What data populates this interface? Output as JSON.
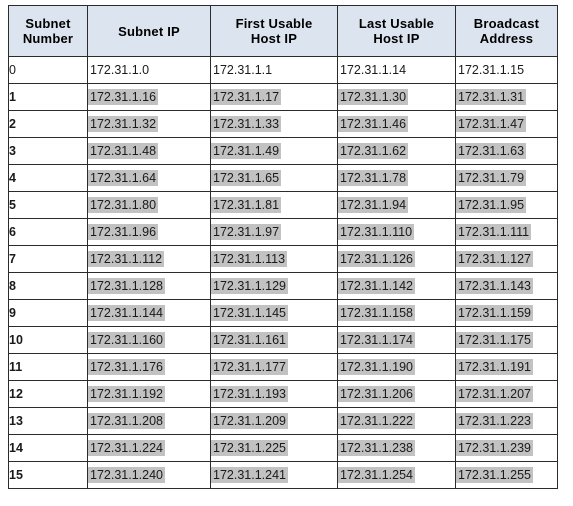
{
  "table": {
    "headers": [
      {
        "line1": "Subnet",
        "line2": "Number"
      },
      {
        "line1": "Subnet IP",
        "line2": ""
      },
      {
        "line1": "First Usable",
        "line2": "Host IP"
      },
      {
        "line1": "Last Usable",
        "line2": "Host IP"
      },
      {
        "line1": "Broadcast",
        "line2": "Address"
      }
    ],
    "rows": [
      {
        "number": "0",
        "subnet_ip": "172.31.1.0",
        "first_host": "172.31.1.1",
        "last_host": "172.31.1.14",
        "broadcast": "172.31.1.15",
        "highlighted": false
      },
      {
        "number": "1",
        "subnet_ip": "172.31.1.16",
        "first_host": "172.31.1.17",
        "last_host": "172.31.1.30",
        "broadcast": "172.31.1.31",
        "highlighted": true
      },
      {
        "number": "2",
        "subnet_ip": "172.31.1.32",
        "first_host": "172.31.1.33",
        "last_host": "172.31.1.46",
        "broadcast": "172.31.1.47",
        "highlighted": true
      },
      {
        "number": "3",
        "subnet_ip": "172.31.1.48",
        "first_host": "172.31.1.49",
        "last_host": "172.31.1.62",
        "broadcast": "172.31.1.63",
        "highlighted": true
      },
      {
        "number": "4",
        "subnet_ip": "172.31.1.64",
        "first_host": "172.31.1.65",
        "last_host": "172.31.1.78",
        "broadcast": "172.31.1.79",
        "highlighted": true
      },
      {
        "number": "5",
        "subnet_ip": "172.31.1.80",
        "first_host": "172.31.1.81",
        "last_host": "172.31.1.94",
        "broadcast": "172.31.1.95",
        "highlighted": true
      },
      {
        "number": "6",
        "subnet_ip": "172.31.1.96",
        "first_host": "172.31.1.97",
        "last_host": "172.31.1.110",
        "broadcast": "172.31.1.111",
        "highlighted": true
      },
      {
        "number": "7",
        "subnet_ip": "172.31.1.112",
        "first_host": "172.31.1.113",
        "last_host": "172.31.1.126",
        "broadcast": "172.31.1.127",
        "highlighted": true
      },
      {
        "number": "8",
        "subnet_ip": "172.31.1.128",
        "first_host": "172.31.1.129",
        "last_host": "172.31.1.142",
        "broadcast": "172.31.1.143",
        "highlighted": true
      },
      {
        "number": "9",
        "subnet_ip": "172.31.1.144",
        "first_host": "172.31.1.145",
        "last_host": "172.31.1.158",
        "broadcast": "172.31.1.159",
        "highlighted": true
      },
      {
        "number": "10",
        "subnet_ip": "172.31.1.160",
        "first_host": "172.31.1.161",
        "last_host": "172.31.1.174",
        "broadcast": "172.31.1.175",
        "highlighted": true
      },
      {
        "number": "11",
        "subnet_ip": "172.31.1.176",
        "first_host": "172.31.1.177",
        "last_host": "172.31.1.190",
        "broadcast": "172.31.1.191",
        "highlighted": true
      },
      {
        "number": "12",
        "subnet_ip": "172.31.1.192",
        "first_host": "172.31.1.193",
        "last_host": "172.31.1.206",
        "broadcast": "172.31.1.207",
        "highlighted": true
      },
      {
        "number": "13",
        "subnet_ip": "172.31.1.208",
        "first_host": "172.31.1.209",
        "last_host": "172.31.1.222",
        "broadcast": "172.31.1.223",
        "highlighted": true
      },
      {
        "number": "14",
        "subnet_ip": "172.31.1.224",
        "first_host": "172.31.1.225",
        "last_host": "172.31.1.238",
        "broadcast": "172.31.1.239",
        "highlighted": true
      },
      {
        "number": "15",
        "subnet_ip": "172.31.1.240",
        "first_host": "172.31.1.241",
        "last_host": "172.31.1.254",
        "broadcast": "172.31.1.255",
        "highlighted": true
      }
    ]
  },
  "colors": {
    "header_bg": "#dce4ef",
    "highlight_bg": "#c2c2c2",
    "border": "#2b2b2b",
    "text": "#1a1a1a"
  }
}
